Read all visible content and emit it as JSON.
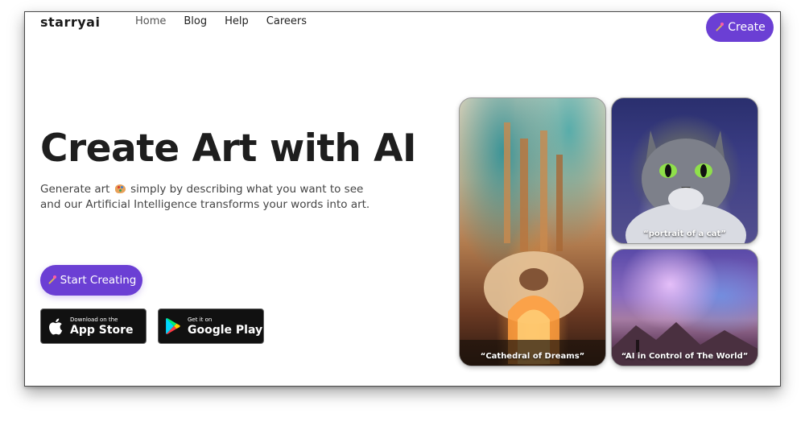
{
  "brand": {
    "logo": "starryai"
  },
  "nav": {
    "items": [
      {
        "label": "Home"
      },
      {
        "label": "Blog"
      },
      {
        "label": "Help"
      },
      {
        "label": "Careers"
      }
    ],
    "create_button": "Create"
  },
  "hero": {
    "title": "Create Art with AI",
    "subtitle_before": "Generate art",
    "subtitle_after": "simply by describing what you want to see and our Artificial Intelligence transforms your words into art.",
    "cta_label": "Start Creating"
  },
  "stores": {
    "apple": {
      "small": "Download on the",
      "big": "App Store"
    },
    "google": {
      "small": "Get it on",
      "big": "Google Play"
    }
  },
  "gallery": [
    {
      "caption": "“Cathedral of Dreams”"
    },
    {
      "caption": "“portrait of a cat”"
    },
    {
      "caption": "“AI in Control of The World”"
    }
  ],
  "colors": {
    "accent": "#6b3fd4",
    "text": "#1e1e1e"
  },
  "icons": [
    "magic-wand-icon",
    "palette-icon",
    "apple-icon",
    "google-play-icon"
  ]
}
